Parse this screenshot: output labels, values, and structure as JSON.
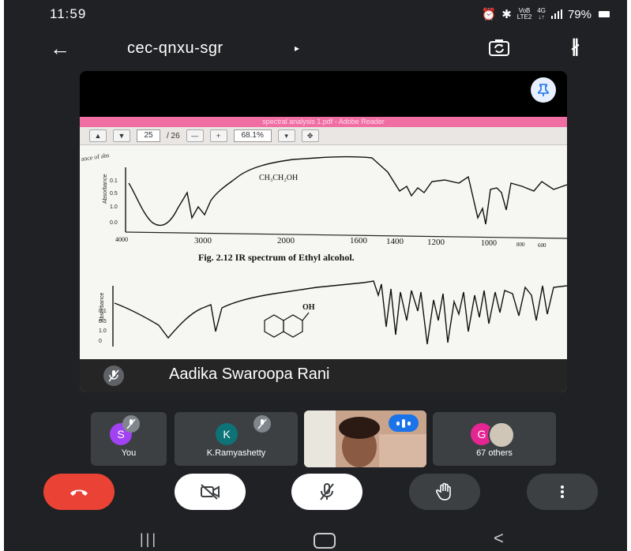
{
  "status_bar": {
    "time": "11:59",
    "volte_top": "VoB",
    "volte_bottom": "LTE2",
    "net_top": "4G",
    "net_bottom": "↓↑",
    "battery": "79%"
  },
  "header": {
    "back_icon": "arrow-left-icon",
    "meeting_code": "cec-qnxu-sgr",
    "caret": "▸"
  },
  "presenter": {
    "pdf_window_title": "spectral analysis 1.pdf - Adobe Reader",
    "page_current": "25",
    "page_total": "/ 26",
    "zoom": "68.1%",
    "spectrum_label_top_left": "ance of abs",
    "molecule": "CH₃CH₂OH",
    "y_ticks": [
      "0.1",
      "0.5",
      "1.0",
      "0.0"
    ],
    "y_axis_label": "Absorbance",
    "x_ticks": [
      "4000",
      "3000",
      "2000",
      "1600",
      "1400",
      "1200",
      "1000",
      "800",
      "600"
    ],
    "figure_caption": "Fig. 2.12    IR spectrum of Ethyl alcohol.",
    "second_y_ticks": [
      "0.1",
      "0.5",
      "1.0",
      "0"
    ],
    "second_molecule_label": "OH",
    "name": "Aadika Swaroopa Rani"
  },
  "participants": [
    {
      "initial": "S",
      "label": "You",
      "color": "#a142f4"
    },
    {
      "initial": "K",
      "label": "K.Ramyashetty",
      "color": "#0d7377"
    },
    {
      "initial": "",
      "label": "",
      "color": ""
    },
    {
      "initial": "G",
      "label": "67 others",
      "color": "#e52592"
    }
  ],
  "controls": [
    "end-call",
    "camera-off",
    "mic-off",
    "raise-hand",
    "more-options"
  ],
  "colors": {
    "background": "#202124",
    "end_call": "#ea4335",
    "accent_blue": "#1a73e8",
    "pdf_titlebar": "#f06ea2"
  }
}
